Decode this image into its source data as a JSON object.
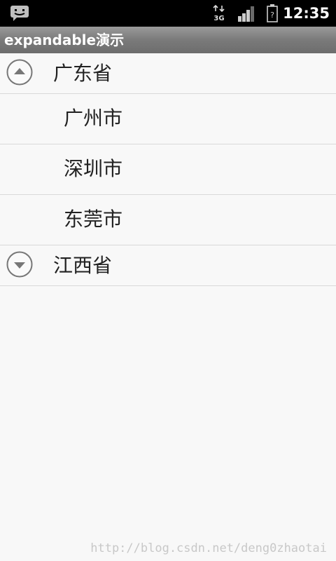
{
  "status_bar": {
    "time": "12:35",
    "network_label": "3G",
    "icons": [
      "message-icon",
      "network-3g-icon",
      "signal-icon",
      "battery-icon"
    ]
  },
  "title_bar": {
    "title": "expandable演示"
  },
  "groups": [
    {
      "label": "广东省",
      "expanded": true,
      "children": [
        {
          "label": "广州市"
        },
        {
          "label": "深圳市"
        },
        {
          "label": "东莞市"
        }
      ]
    },
    {
      "label": "江西省",
      "expanded": false,
      "children": []
    }
  ],
  "watermark": "http://blog.csdn.net/deng0zhaotai",
  "colors": {
    "background": "#f8f8f8",
    "status_bar": "#000000",
    "title_bar": "#7a7a7a",
    "divider": "#d9d9d9",
    "text": "#222222"
  }
}
